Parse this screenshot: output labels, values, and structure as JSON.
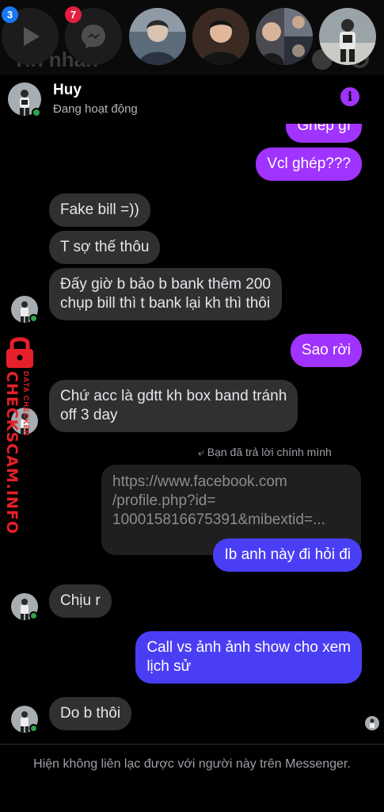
{
  "chat_heads": {
    "faded_title": "Tin nhắn",
    "items": [
      {
        "name": "video-app-head",
        "badge": "3"
      },
      {
        "name": "messenger-app-head",
        "badge": "7"
      },
      {
        "name": "contact-head-1"
      },
      {
        "name": "contact-head-2"
      },
      {
        "name": "contact-head-3"
      },
      {
        "name": "contact-head-4"
      }
    ]
  },
  "header": {
    "name": "Huy",
    "status": "Đang hoạt động",
    "info_icon": "i"
  },
  "messages": {
    "m1": "Ghép gì",
    "m2": "Vcl ghép???",
    "m3": "Fake bill =))",
    "m4": "T sợ thế thôu",
    "m5_line1": "Đấy giờ b bảo b bank thêm 200",
    "m5_line2": "chụp bill thì t bank lại kh thì thôi",
    "m6": "Sao rời",
    "m7_line1": "Chứ acc là gdtt kh box band tránh",
    "m7_line2": "off 3 day",
    "reply_note": "Bạn đã trả lời chính mình",
    "quoted_line1": "https://www.facebook.com",
    "quoted_line2": "/profile.php?id=",
    "quoted_line3": "100015816675391&mibextid=...",
    "m8": "Ib anh này đi hỏi đi",
    "m9": "Chịu r",
    "m10_line1": "Call vs ảnh ảnh show cho xem",
    "m10_line2": "lịch sử",
    "m11": "Do b thôi"
  },
  "watermark": {
    "main": "CHECKSCAM.INFO",
    "sub": "DATA CHECKER"
  },
  "footer": {
    "text": "Hiện không liên lạc được với người này trên Messenger."
  },
  "colors": {
    "purple": "#a033ff",
    "blue": "#4a3ef5",
    "incoming": "#303030",
    "online": "#31a24c",
    "watermark": "#e5202a"
  }
}
